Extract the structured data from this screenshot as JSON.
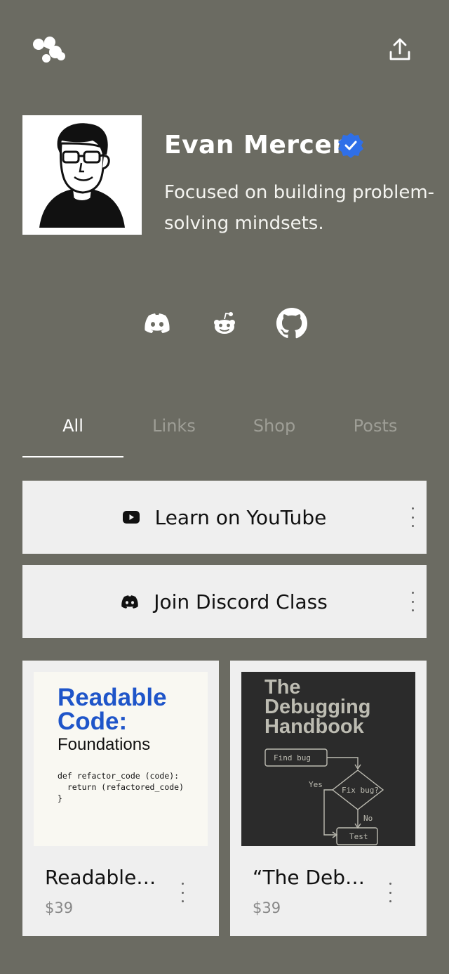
{
  "profile": {
    "name": "Evan Mercer",
    "bio": "Focused on building problem-solving mindsets."
  },
  "social": {
    "icons": [
      "discord-icon",
      "reddit-icon",
      "github-icon"
    ]
  },
  "tabs": [
    {
      "label": "All",
      "active": true
    },
    {
      "label": "Links",
      "active": false
    },
    {
      "label": "Shop",
      "active": false
    },
    {
      "label": "Posts",
      "active": false
    }
  ],
  "links": [
    {
      "label": "Learn on YouTube",
      "icon": "youtube-icon"
    },
    {
      "label": "Join Discord Class",
      "icon": "discord-icon"
    }
  ],
  "products": [
    {
      "title": "Readable…",
      "price": "$39",
      "cover": {
        "title_line1": "Readable",
        "title_line2": "Code:",
        "subtitle": "Foundations",
        "code": "def refactor_code (code):\n  return (refactored_code)\n}"
      }
    },
    {
      "title": "“The Deb…",
      "price": "$39",
      "cover": {
        "title_line1": "The",
        "title_line2": "Debugging",
        "title_line3": "Handbook",
        "flow_find": "Find bug",
        "flow_fix": "Fix bug?",
        "flow_yes": "Yes",
        "flow_no": "No",
        "flow_test": "Test"
      }
    }
  ],
  "colors": {
    "background": "#6b6b62",
    "card": "#efefef",
    "verified": "#2f6fe8",
    "cover_blue": "#1f55c9"
  }
}
